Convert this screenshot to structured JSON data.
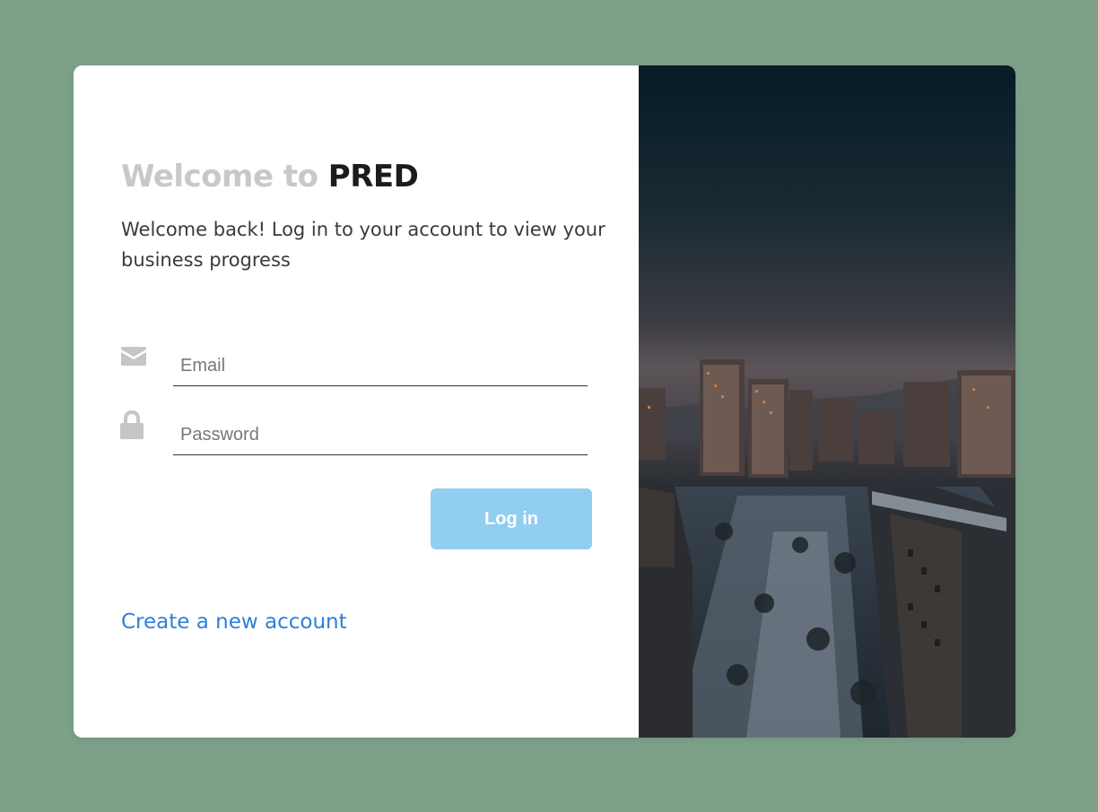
{
  "login": {
    "title_prefix": "Welcome to ",
    "title_brand": "PRED",
    "subtitle": "Welcome back! Log in to your account to view your business progress",
    "email": {
      "icon": "envelope-icon",
      "placeholder": "Email",
      "value": ""
    },
    "password": {
      "icon": "lock-icon",
      "placeholder": "Password",
      "value": ""
    },
    "login_button_label": "Log in",
    "create_account_link": "Create a new account"
  },
  "colors": {
    "page_background": "#7ca088",
    "card_background": "#ffffff",
    "title_muted": "#c8c8c8",
    "title_brand": "#1c1c1c",
    "button": "#92cdf2",
    "link": "#2f7fd8",
    "icon": "#c6c6c6"
  },
  "side_image": {
    "subject": "dusk-city-skyline-snow"
  }
}
